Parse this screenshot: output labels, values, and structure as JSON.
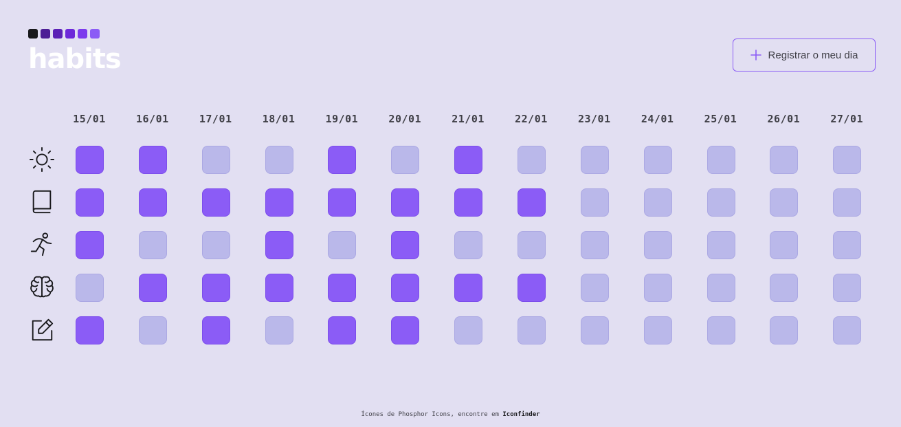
{
  "app": {
    "logo_text": "habits",
    "logo_colors": [
      "#18181B",
      "#4C1D95",
      "#5B21B6",
      "#6D28D9",
      "#7C3AED",
      "#8B5CF6"
    ]
  },
  "header": {
    "register_button_label": "Registrar o meu dia",
    "register_button_icon": "plus-icon"
  },
  "dates": [
    "15/01",
    "16/01",
    "17/01",
    "18/01",
    "19/01",
    "20/01",
    "21/01",
    "22/01",
    "23/01",
    "24/01",
    "25/01",
    "26/01",
    "27/01"
  ],
  "habits": [
    {
      "icon": "sun-icon",
      "days": [
        1,
        1,
        0,
        0,
        1,
        0,
        1,
        0,
        0,
        0,
        0,
        0,
        0
      ]
    },
    {
      "icon": "book-icon",
      "days": [
        1,
        1,
        1,
        1,
        1,
        1,
        1,
        1,
        0,
        0,
        0,
        0,
        0
      ]
    },
    {
      "icon": "person-running-icon",
      "days": [
        1,
        0,
        0,
        1,
        0,
        1,
        0,
        0,
        0,
        0,
        0,
        0,
        0
      ]
    },
    {
      "icon": "brain-icon",
      "days": [
        0,
        1,
        1,
        1,
        1,
        1,
        1,
        1,
        0,
        0,
        0,
        0,
        0
      ]
    },
    {
      "icon": "note-pencil-icon",
      "days": [
        1,
        0,
        1,
        0,
        1,
        1,
        0,
        0,
        0,
        0,
        0,
        0,
        0
      ]
    }
  ],
  "colors": {
    "done": "#8B5CF6",
    "empty": "#BAB8EA",
    "accent": "#8B5CF6",
    "background": "#E2DFF2"
  },
  "footer": {
    "text": "Ícones de Phosphor Icons, encontre em",
    "link_text": "Iconfinder"
  }
}
